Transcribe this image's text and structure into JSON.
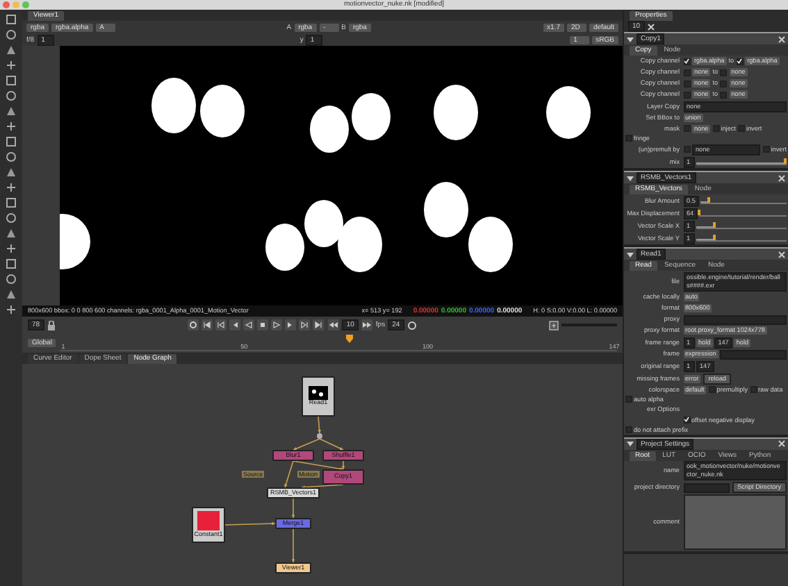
{
  "window": {
    "title": "motionvector_nuke.nk [modified]"
  },
  "viewer": {
    "tab": "Viewer1",
    "toolbar_1": {
      "left": [
        {
          "kind": "dropdown",
          "text": "rgba"
        },
        {
          "kind": "dropdown",
          "text": "rgba.alpha"
        },
        {
          "kind": "dropdown",
          "text": "A"
        }
      ],
      "middle": [
        {
          "kind": "label",
          "text": "A"
        },
        {
          "kind": "dropdown",
          "text": "rgba"
        },
        {
          "kind": "dropdown",
          "text": "-"
        },
        {
          "kind": "label",
          "text": "B"
        },
        {
          "kind": "dropdown",
          "text": "rgba"
        }
      ],
      "right": [
        {
          "kind": "dropdown",
          "text": "x1.7"
        },
        {
          "kind": "dropdown",
          "text": "2D"
        },
        {
          "kind": "dropdown",
          "text": "default"
        }
      ]
    },
    "toolbar_2": {
      "left": [
        {
          "kind": "label",
          "text": "f/8"
        },
        {
          "kind": "field",
          "text": "1"
        }
      ],
      "middle": [
        {
          "kind": "label",
          "text": "y"
        },
        {
          "kind": "field",
          "text": "1"
        }
      ],
      "right": [
        {
          "kind": "dropdown",
          "text": "1"
        },
        {
          "kind": "dropdown",
          "text": "sRGB"
        }
      ]
    },
    "info": {
      "format": "800x600 bbox: 0 0 800 600 channels: rgba_0001_Alpha_0001_Motion_Vector",
      "position": "x= 513 y= 192",
      "values": [
        {
          "text": "0.00000",
          "color": "#e03030"
        },
        {
          "text": "0.00000",
          "color": "#30c030"
        },
        {
          "text": "0.00000",
          "color": "#4060ff"
        },
        {
          "text": "0.00000",
          "color": "#e0e0e0"
        }
      ],
      "hsv": "H: 0 S:0.00 V:0.00 L: 0.00000"
    }
  },
  "transport": {
    "frame": "78",
    "increment": "10",
    "fps_label": "fps",
    "fps": "24"
  },
  "timeline": {
    "range": "Global",
    "ticks": [
      "1",
      "50",
      "100",
      "147"
    ],
    "level": 0.52
  },
  "node_graph": {
    "tabs": [
      {
        "label": "Curve Editor",
        "selected": false
      },
      {
        "label": "Dope Sheet",
        "selected": false
      },
      {
        "label": "Node Graph",
        "selected": true
      }
    ],
    "nodes": [
      {
        "kind": "read",
        "label": "Read1",
        "color": "#c8c8c8"
      },
      {
        "kind": "dot",
        "color": "#b0b0b0"
      },
      {
        "kind": "op",
        "label": "Blur1",
        "color": "#b0487a"
      },
      {
        "kind": "op",
        "label": "Shuffle1",
        "color": "#b0487a"
      },
      {
        "kind": "op",
        "label": "Copy1",
        "color": "#b0487a"
      },
      {
        "kind": "op",
        "label": "RSMB_Vectors1",
        "color": "#d8d8d8",
        "input_labels": [
          "Source",
          "Motion"
        ]
      },
      {
        "kind": "op",
        "label": "Merge1",
        "color": "#6a6ae0"
      },
      {
        "kind": "constant",
        "label": "Constant1",
        "color": "#e8203a"
      },
      {
        "kind": "op",
        "label": "Viewer1",
        "color": "#f0c890"
      }
    ]
  },
  "properties": {
    "title": "Properties",
    "count": "10",
    "panels": [
      {
        "name": "Copy1",
        "tabs": [
          {
            "label": "Copy",
            "selected": true
          },
          {
            "label": "Node",
            "selected": false
          }
        ],
        "rows": [
          {
            "label": "Copy channel",
            "controls": [
              {
                "kind": "checkbox",
                "checked": true
              },
              {
                "kind": "dropdown",
                "text": "rgba.alpha"
              },
              {
                "kind": "text",
                "text": "to"
              },
              {
                "kind": "checkbox",
                "checked": true
              },
              {
                "kind": "dropdown",
                "text": "rgba.alpha"
              }
            ]
          },
          {
            "label": "Copy channel",
            "controls": [
              {
                "kind": "checkbox",
                "checked": false
              },
              {
                "kind": "dropdown",
                "text": "none"
              },
              {
                "kind": "text",
                "text": "to"
              },
              {
                "kind": "checkbox",
                "checked": false
              },
              {
                "kind": "dropdown",
                "text": "none"
              }
            ]
          },
          {
            "label": "Copy channel",
            "controls": [
              {
                "kind": "checkbox",
                "checked": false
              },
              {
                "kind": "dropdown",
                "text": "none"
              },
              {
                "kind": "text",
                "text": "to"
              },
              {
                "kind": "checkbox",
                "checked": false
              },
              {
                "kind": "dropdown",
                "text": "none"
              }
            ]
          },
          {
            "label": "Copy channel",
            "controls": [
              {
                "kind": "checkbox",
                "checked": false
              },
              {
                "kind": "dropdown",
                "text": "none"
              },
              {
                "kind": "text",
                "text": "to"
              },
              {
                "kind": "checkbox",
                "checked": false
              },
              {
                "kind": "dropdown",
                "text": "none"
              }
            ]
          },
          {
            "label": "Layer Copy",
            "controls": [
              {
                "kind": "wide",
                "text": "none"
              }
            ]
          },
          {
            "label": "Set BBox to",
            "controls": [
              {
                "kind": "dropdown",
                "text": "union"
              }
            ]
          },
          {
            "label": "mask",
            "controls": [
              {
                "kind": "checkbox",
                "checked": false
              },
              {
                "kind": "dropdown",
                "text": "none"
              },
              {
                "kind": "checkbox",
                "checked": false,
                "text": "inject"
              },
              {
                "kind": "checkbox",
                "checked": false,
                "text": "invert"
              },
              {
                "kind": "checkbox",
                "checked": false,
                "text": "fringe"
              }
            ]
          },
          {
            "label": "(un)premult by",
            "controls": [
              {
                "kind": "checkbox",
                "checked": false
              },
              {
                "kind": "wide",
                "text": "none"
              },
              {
                "kind": "checkbox",
                "checked": false,
                "text": "invert"
              }
            ]
          },
          {
            "label": "mix",
            "controls": [
              {
                "kind": "field",
                "text": "1"
              },
              {
                "kind": "slider",
                "level": 1
              }
            ]
          }
        ]
      },
      {
        "name": "RSMB_Vectors1",
        "tabs": [
          {
            "label": "RSMB_Vectors",
            "selected": true
          },
          {
            "label": "Node",
            "selected": false
          }
        ],
        "rows": [
          {
            "label": "Blur Amount",
            "controls": [
              {
                "kind": "field",
                "text": "0.5"
              },
              {
                "kind": "slider",
                "level": 0.1
              }
            ]
          },
          {
            "label": "Max Displacement",
            "controls": [
              {
                "kind": "field",
                "text": "64"
              },
              {
                "kind": "slider",
                "level": 0
              }
            ]
          },
          {
            "label": "Vector Scale X",
            "controls": [
              {
                "kind": "field",
                "text": "1"
              },
              {
                "kind": "slider",
                "level": 0.2
              }
            ]
          },
          {
            "label": "Vector Scale Y",
            "controls": [
              {
                "kind": "field",
                "text": "1"
              },
              {
                "kind": "slider",
                "level": 0.2
              }
            ]
          }
        ]
      },
      {
        "name": "Read1",
        "tabs": [
          {
            "label": "Read",
            "selected": true
          },
          {
            "label": "Sequence",
            "selected": false
          },
          {
            "label": "Node",
            "selected": false
          }
        ],
        "rows": [
          {
            "label": "file",
            "controls": [
              {
                "kind": "wide",
                "text": "ossible.engine/tutorial/render/balls####.exr"
              }
            ]
          },
          {
            "label": "cache locally",
            "controls": [
              {
                "kind": "dropdown",
                "text": "auto"
              }
            ]
          },
          {
            "label": "format",
            "controls": [
              {
                "kind": "dropdown",
                "text": "800x600"
              }
            ]
          },
          {
            "label": "proxy",
            "controls": [
              {
                "kind": "wide"
              }
            ]
          },
          {
            "label": "proxy format",
            "controls": [
              {
                "kind": "dropdown",
                "text": "root.proxy_format 1024x778"
              }
            ]
          },
          {
            "label": "frame range",
            "controls": [
              {
                "kind": "field",
                "text": "1"
              },
              {
                "kind": "dropdown",
                "text": "hold"
              },
              {
                "kind": "field",
                "text": "147"
              },
              {
                "kind": "dropdown",
                "text": "hold"
              }
            ]
          },
          {
            "label": "frame",
            "controls": [
              {
                "kind": "dropdown",
                "text": "expression"
              },
              {
                "kind": "wide"
              }
            ]
          },
          {
            "label": "original range",
            "controls": [
              {
                "kind": "field",
                "text": "1"
              },
              {
                "kind": "field",
                "text": "147"
              }
            ]
          },
          {
            "label": "missing frames",
            "controls": [
              {
                "kind": "dropdown",
                "text": "error"
              },
              {
                "kind": "button",
                "text": "reload"
              }
            ]
          },
          {
            "label": "colorspace",
            "controls": [
              {
                "kind": "dropdown",
                "text": "default"
              },
              {
                "kind": "checkbox",
                "checked": false,
                "text": "premultiply"
              },
              {
                "kind": "checkbox",
                "checked": false,
                "text": "raw data"
              },
              {
                "kind": "checkbox",
                "checked": false,
                "text": "auto alpha"
              }
            ]
          },
          {
            "label": "exr Options",
            "controls": []
          },
          {
            "controls": [
              {
                "kind": "checkbox",
                "checked": true,
                "text": "offset negative display"
              },
              {
                "kind": "checkbox",
                "checked": false,
                "text": "do not attach prefix"
              }
            ]
          }
        ]
      },
      {
        "name": "Project Settings",
        "tabs": [
          {
            "label": "Root",
            "selected": true
          },
          {
            "label": "LUT",
            "selected": false
          },
          {
            "label": "OCIO",
            "selected": false
          },
          {
            "label": "Views",
            "selected": false
          },
          {
            "label": "Python",
            "selected": false
          }
        ],
        "rows": [
          {
            "label": "name",
            "controls": [
              {
                "kind": "wide",
                "text": "ook_motionvector/nuke/motionvector_nuke.nk"
              }
            ]
          },
          {
            "label": "project directory",
            "controls": [
              {
                "kind": "wide"
              },
              {
                "kind": "button",
                "text": "Script Directory"
              }
            ]
          },
          {
            "label": "comment",
            "controls": [
              {
                "kind": "area"
              }
            ]
          }
        ]
      }
    ]
  }
}
